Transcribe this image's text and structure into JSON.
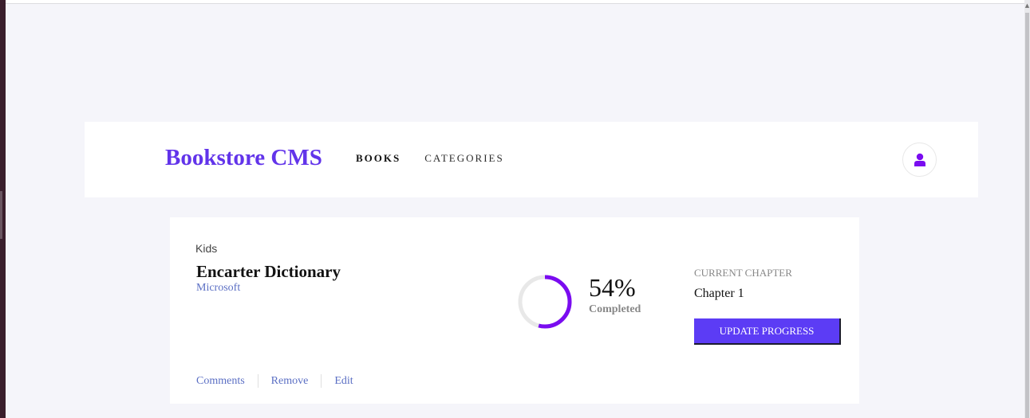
{
  "header": {
    "brand": "Bookstore CMS",
    "nav": [
      {
        "label": "BOOKS",
        "active": true
      },
      {
        "label": "CATEGORIES",
        "active": false
      }
    ],
    "avatar_icon": "user-icon"
  },
  "book": {
    "genre": "Kids",
    "title": "Encarter Dictionary",
    "author": "Microsoft",
    "actions": [
      "Comments",
      "Remove",
      "Edit"
    ],
    "progress": {
      "percent": 54,
      "percent_text": "54%",
      "completed_label": "Completed"
    },
    "chapter": {
      "label": "CURRENT CHAPTER",
      "value": "Chapter 1"
    },
    "update_button": "UPDATE PROGRESS"
  },
  "colors": {
    "brand": "#6234ea",
    "progress": "#7a0cf0",
    "progress_track": "#e8e8e8",
    "button": "#5c3cf5",
    "link": "#5b6fc4",
    "background": "#f5f5fa"
  }
}
